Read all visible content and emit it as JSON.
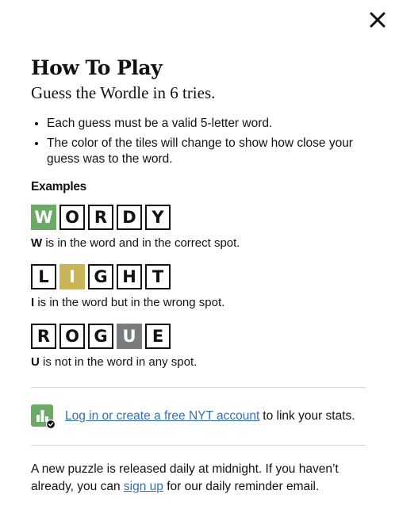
{
  "modal": {
    "title": "How To Play",
    "subtitle": "Guess the Wordle in 6 tries."
  },
  "rules": [
    "Each guess must be a valid 5-letter word.",
    "The color of the tiles will change to show how close your guess was to the word."
  ],
  "examples": {
    "heading": "Examples",
    "items": [
      {
        "letters": [
          "W",
          "O",
          "R",
          "D",
          "Y"
        ],
        "states": [
          "correct",
          "empty",
          "empty",
          "empty",
          "empty"
        ],
        "highlight": "W",
        "explanation": "is in the word and in the correct spot."
      },
      {
        "letters": [
          "L",
          "I",
          "G",
          "H",
          "T"
        ],
        "states": [
          "empty",
          "present",
          "empty",
          "empty",
          "empty"
        ],
        "highlight": "I",
        "explanation": "is in the word but in the wrong spot."
      },
      {
        "letters": [
          "R",
          "O",
          "G",
          "U",
          "E"
        ],
        "states": [
          "empty",
          "empty",
          "empty",
          "absent",
          "empty"
        ],
        "highlight": "U",
        "explanation": "is not in the word in any spot."
      }
    ]
  },
  "login": {
    "link_text": "Log in or create a free NYT account",
    "rest_text": "to link your stats.",
    "icon": "stats-chart-icon"
  },
  "footer": {
    "text_before": "A new puzzle is released daily at midnight. If you haven’t already, you can",
    "link_text": "sign up",
    "text_after": "for our daily reminder email."
  },
  "colors": {
    "correct": "#6aaa64",
    "present": "#c9b458",
    "absent": "#787c7e",
    "link": "#346eb7"
  }
}
